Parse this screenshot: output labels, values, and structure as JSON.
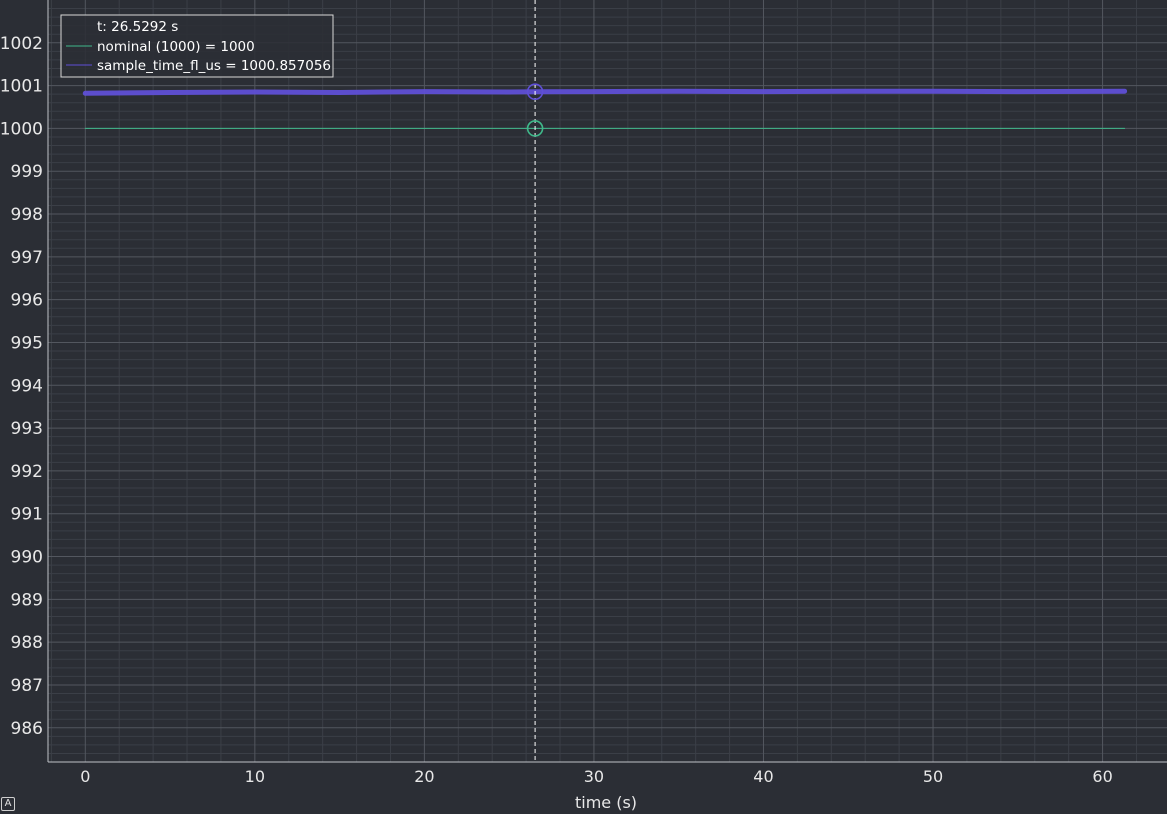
{
  "chart_data": {
    "type": "line",
    "title": "",
    "xlabel": "time (s)",
    "ylabel": "",
    "xlim": [
      -2.2,
      63.8
    ],
    "ylim": [
      985.2,
      1003.0
    ],
    "xticks": [
      0,
      10,
      20,
      30,
      40,
      50,
      60
    ],
    "yticks": [
      986,
      987,
      988,
      989,
      990,
      991,
      992,
      993,
      994,
      995,
      996,
      997,
      998,
      999,
      1000,
      1001,
      1002
    ],
    "grid": true,
    "legend_position": "top-left",
    "cursor": {
      "label": "t: 26.5292 s",
      "x": 26.5292
    },
    "series": [
      {
        "name": "nominal (1000)",
        "legend_label": "nominal (1000) = 1000",
        "color": "#3fb88a",
        "x": [
          0,
          61.3
        ],
        "y": [
          1000,
          1000
        ],
        "cursor_value": 1000
      },
      {
        "name": "sample_time_fl_us",
        "legend_label": "sample_time_fl_us = 1000.857056",
        "color": "#5f4fd6",
        "x": [
          0,
          5,
          10,
          15,
          20,
          25,
          26.5292,
          30,
          35,
          40,
          45,
          50,
          55,
          61.3
        ],
        "y": [
          1000.82,
          1000.84,
          1000.85,
          1000.84,
          1000.86,
          1000.85,
          1000.857056,
          1000.86,
          1000.87,
          1000.86,
          1000.87,
          1000.87,
          1000.86,
          1000.87
        ],
        "cursor_value": 1000.857056
      }
    ]
  },
  "ui": {
    "corner_badge": "A"
  }
}
